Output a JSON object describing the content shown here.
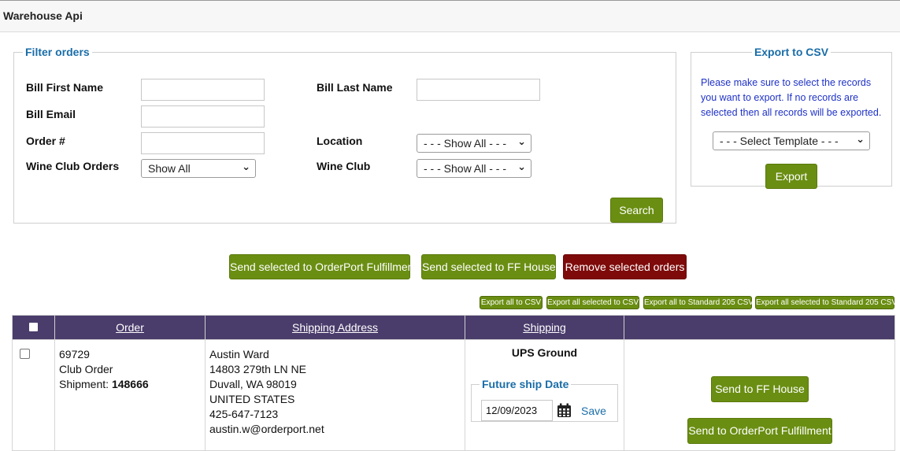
{
  "app": {
    "title": "Warehouse Api"
  },
  "filter": {
    "legend": "Filter orders",
    "bill_first_name": {
      "label": "Bill First Name",
      "value": ""
    },
    "bill_last_name": {
      "label": "Bill Last Name",
      "value": ""
    },
    "bill_email": {
      "label": "Bill Email",
      "value": ""
    },
    "order_number": {
      "label": "Order #",
      "value": ""
    },
    "location": {
      "label": "Location",
      "selected": "- - - Show All - - -"
    },
    "wine_club_orders": {
      "label": "Wine Club Orders",
      "selected": "Show All"
    },
    "wine_club": {
      "label": "Wine Club",
      "selected": "- - - Show All - - -"
    },
    "search_label": "Search"
  },
  "export_csv": {
    "legend": "Export to CSV",
    "note": "Please make sure to select the records you want to export. If no records are selected then all records will be exported.",
    "template_selected": "- - - Select Template - - -",
    "export_label": "Export"
  },
  "actions": {
    "send_orderport": "Send selected to OrderPort Fulfillment",
    "send_ff_house": "Send selected to FF House",
    "remove_selected": "Remove selected orders"
  },
  "mini_exports": {
    "export_all": "Export all to CSV",
    "export_selected": "Export all selected to CSV",
    "export_all_205": "Export all to Standard 205 CSV",
    "export_selected_205": "Export all selected to Standard 205 CSV"
  },
  "table": {
    "headers": {
      "order": "Order",
      "shipping_address": "Shipping Address",
      "shipping": "Shipping"
    },
    "rows": [
      {
        "order_id": "69729",
        "order_type": "Club Order",
        "shipment_label": "Shipment:",
        "shipment_number": "148666",
        "address": {
          "name": "Austin Ward",
          "street": "14803 279th LN NE",
          "city_state_zip": "Duvall, WA 98019",
          "country": "UNITED STATES",
          "phone": "425-647-7123",
          "email": "austin.w@orderport.net"
        },
        "shipping_method": "UPS Ground",
        "future_ship_legend": "Future ship Date",
        "future_ship_date": "12/09/2023",
        "save_label": "Save",
        "send_ff_house": "Send to FF House",
        "send_orderport": "Send to OrderPort Fulfillment"
      }
    ]
  }
}
